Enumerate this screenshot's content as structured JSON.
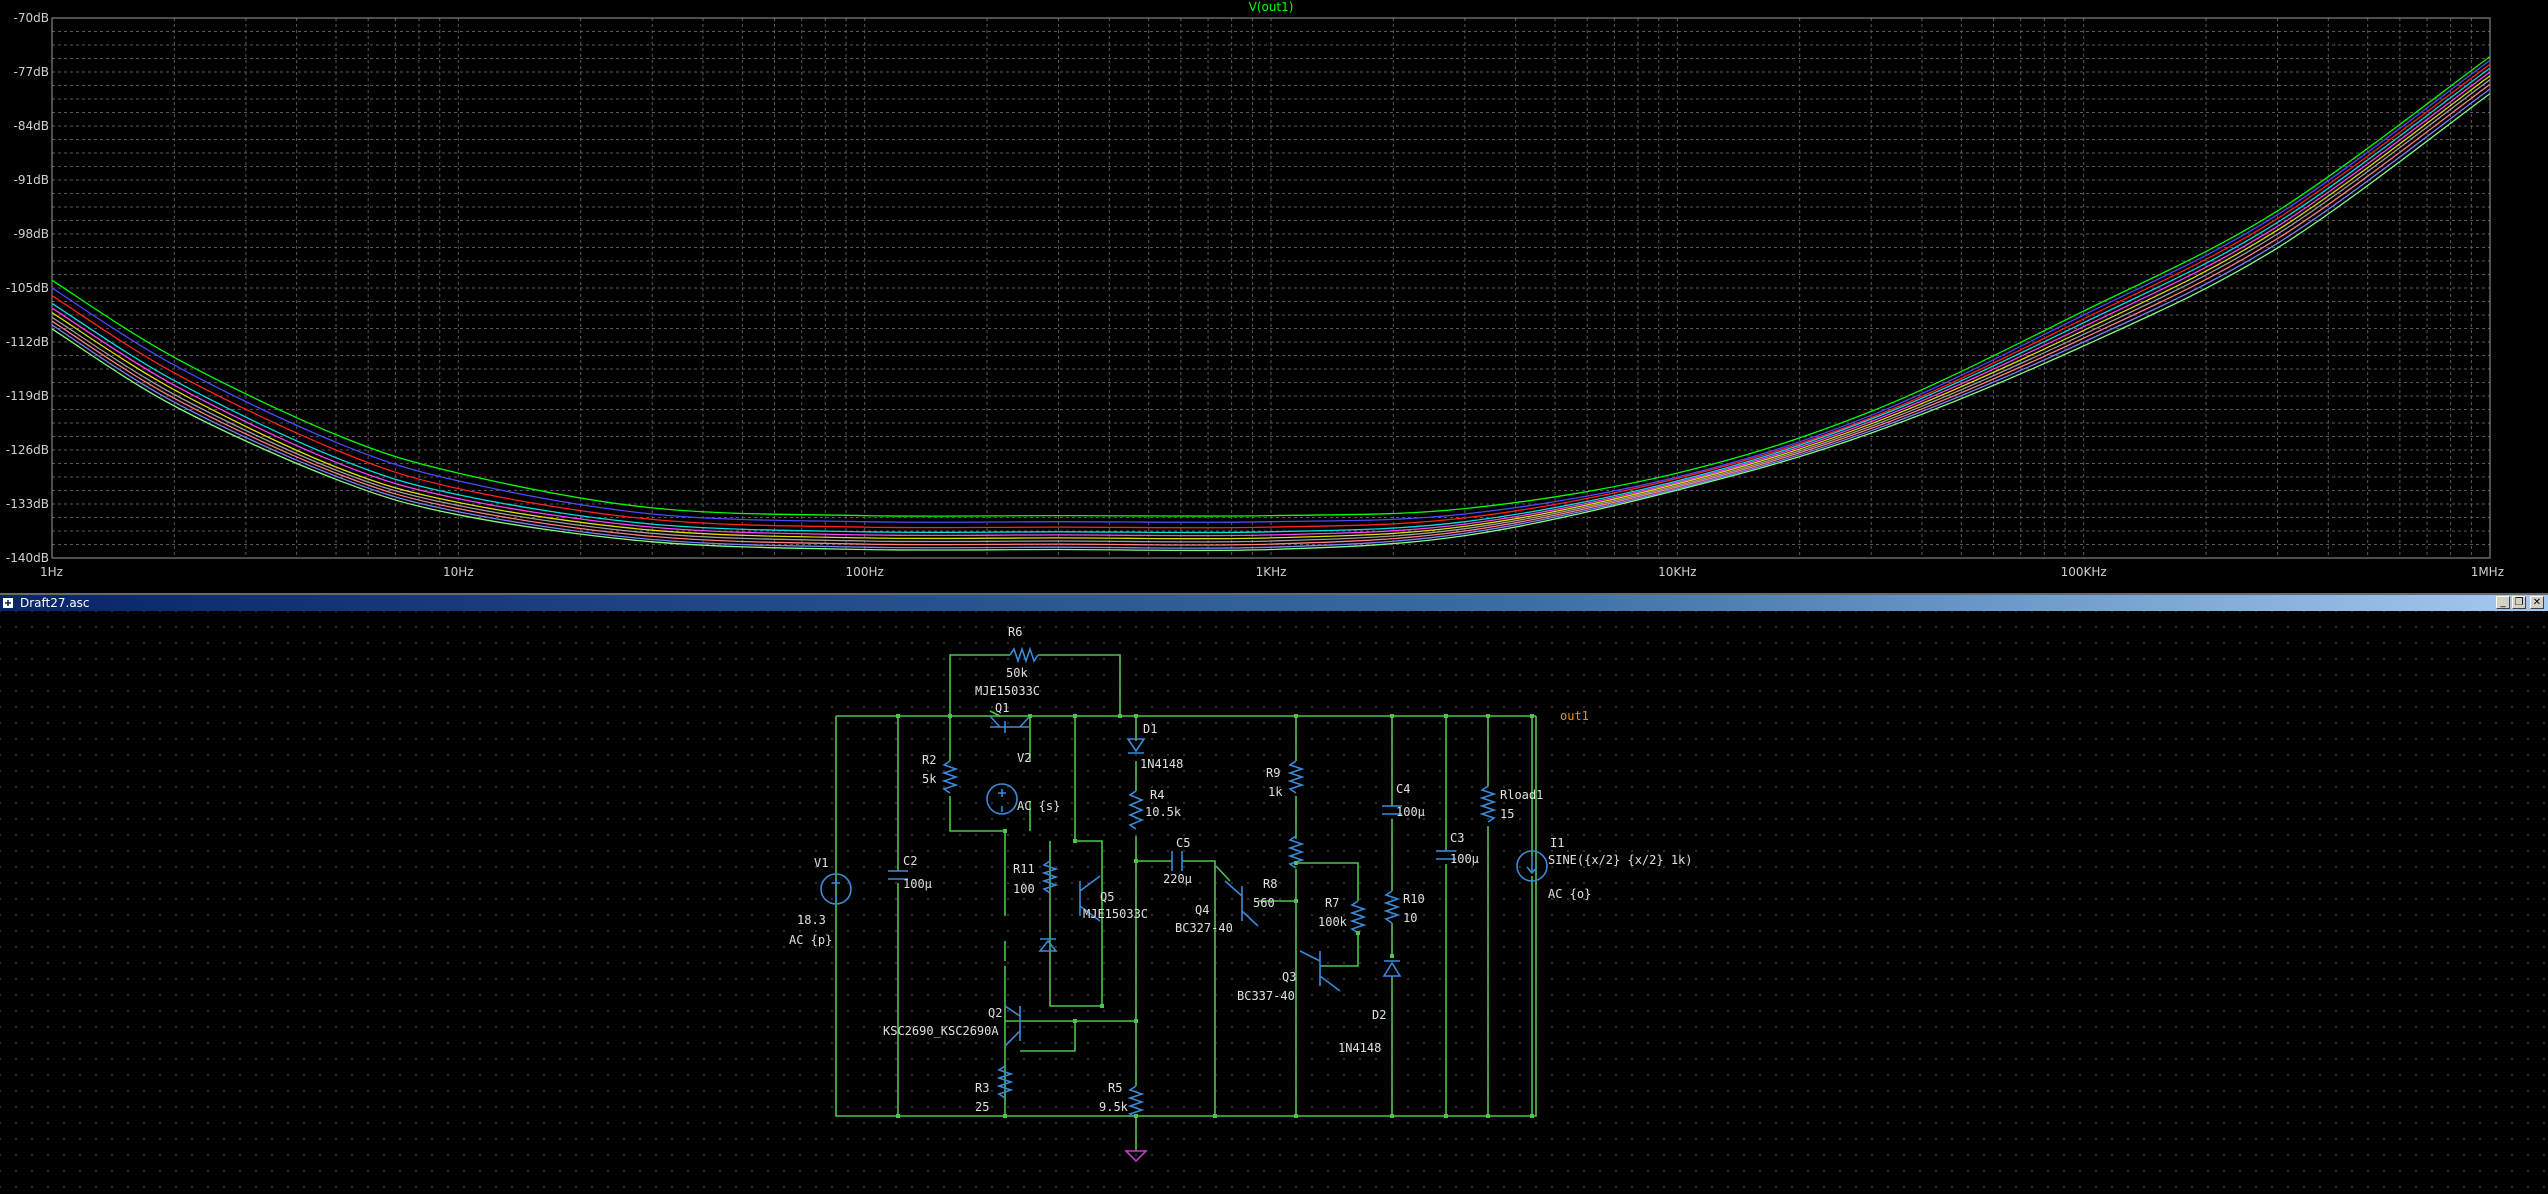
{
  "plot": {
    "trace_title": "V(out1)",
    "y_ticks": [
      "-70dB",
      "-77dB",
      "-84dB",
      "-91dB",
      "-98dB",
      "-105dB",
      "-112dB",
      "-119dB",
      "-126dB",
      "-133dB",
      "-140dB"
    ],
    "x_ticks": [
      "1Hz",
      "10Hz",
      "100Hz",
      "1KHz",
      "10KHz",
      "100KHz",
      "1MHz"
    ],
    "colors": {
      "title": "#00ff00",
      "grid": "#5a5a5a",
      "axis_text": "#d0d0d0"
    }
  },
  "chart_data": {
    "type": "line",
    "title": "V(out1)",
    "x_scale": "log",
    "xlim_hz": [
      1,
      1000000
    ],
    "ylim_db": [
      -140,
      -70
    ],
    "x_hz": [
      1,
      2,
      5,
      10,
      30,
      100,
      300,
      1000,
      3000,
      10000,
      30000,
      100000,
      300000,
      1000000
    ],
    "series": [
      {
        "color": "#00ff00",
        "values": [
          -104,
          -114,
          -124,
          -129,
          -133.5,
          -134.5,
          -134.5,
          -134.5,
          -133.6,
          -129,
          -121,
          -108,
          -95,
          -75
        ]
      },
      {
        "color": "#4a4aff",
        "values": [
          -105,
          -115,
          -125,
          -130,
          -134.3,
          -135.3,
          -135.3,
          -135.3,
          -134.3,
          -129.5,
          -121.5,
          -108.5,
          -95.5,
          -75.5
        ]
      },
      {
        "color": "#ff2020",
        "values": [
          -106,
          -116,
          -126,
          -131,
          -135,
          -136,
          -136,
          -136,
          -134.8,
          -129.7,
          -121.8,
          -109,
          -96,
          -76
        ]
      },
      {
        "color": "#00e0e0",
        "values": [
          -107,
          -117,
          -127,
          -131.8,
          -135.6,
          -136.6,
          -136.6,
          -136.6,
          -135.3,
          -130,
          -122,
          -109.5,
          -96.5,
          -76.5
        ]
      },
      {
        "color": "#ff40ff",
        "values": [
          -107.6,
          -117.6,
          -127.6,
          -132.3,
          -136,
          -137,
          -137,
          -137,
          -135.6,
          -130.2,
          -122.3,
          -110,
          -97,
          -77
        ]
      },
      {
        "color": "#e0e000",
        "values": [
          -108.2,
          -118.2,
          -128.2,
          -132.8,
          -136.4,
          -137.4,
          -137.4,
          -137.4,
          -135.9,
          -130.4,
          -122.6,
          -110.5,
          -97.5,
          -77.5
        ]
      },
      {
        "color": "#a0a0a0",
        "values": [
          -108.8,
          -118.8,
          -128.6,
          -133.2,
          -136.8,
          -137.8,
          -137.8,
          -137.8,
          -136.2,
          -130.6,
          -122.9,
          -111,
          -98,
          -78
        ]
      },
      {
        "color": "#ff8080",
        "values": [
          -109.3,
          -119.3,
          -129,
          -133.6,
          -137.2,
          -138.2,
          -138.2,
          -138.2,
          -136.5,
          -130.8,
          -123.2,
          -111.5,
          -98.6,
          -78.6
        ]
      },
      {
        "color": "#8080ff",
        "values": [
          -109.8,
          -119.8,
          -129.4,
          -134,
          -137.6,
          -138.6,
          -138.6,
          -138.6,
          -136.8,
          -131,
          -123.5,
          -112,
          -99.2,
          -79.2
        ]
      },
      {
        "color": "#80ff80",
        "values": [
          -110.3,
          -120.3,
          -129.8,
          -134.4,
          -137.9,
          -138.9,
          -138.9,
          -138.9,
          -137.1,
          -131.2,
          -123.8,
          -112.5,
          -99.8,
          -79.8
        ]
      }
    ]
  },
  "window": {
    "title": "Draft27.asc",
    "btn_min": "_",
    "btn_restore": "❐",
    "btn_close": "✕"
  },
  "schematic": {
    "colors": {
      "wire": "#4ec24e",
      "part": "#3a8ad8",
      "text": "#e0e0e0",
      "net_label": "#ff8c00",
      "ground": "#c040c0"
    },
    "labels": {
      "r6_name": "R6",
      "r6_val": "50k",
      "q1_model": "MJE15033C",
      "q1_name": "Q1",
      "d1_name": "D1",
      "d1_model": "1N4148",
      "net_out": "out1",
      "r2_name": "R2",
      "r2_val": "5k",
      "v2_name": "V2",
      "v2_ac": "AC {s}",
      "r4_name": "R4",
      "r4_val": "10.5k",
      "r9_name": "R9",
      "r9_val": "1k",
      "c4_name": "C4",
      "c4_val": "100µ",
      "rload_name": "Rload1",
      "rload_val": "15",
      "c5_name": "C5",
      "c5_val": "220µ",
      "c3_name": "C3",
      "c3_val": "100µ",
      "i1_name": "I1",
      "i1_val": "SINE({x/2} {x/2} 1k)",
      "i1_ac": "AC {o}",
      "v1_name": "V1",
      "v1_val": "18.3",
      "v1_ac": "AC {p}",
      "c2_name": "C2",
      "c2_val": "100µ",
      "r11_name": "R11",
      "r11_val": "100",
      "q5_name": "Q5",
      "q5_model": "MJE15033C",
      "r8_name": "R8",
      "r8_val": "560",
      "q4_name": "Q4",
      "q4_model": "BC327-40",
      "r7_name": "R7",
      "r7_val": "100k",
      "r10_name": "R10",
      "r10_val": "10",
      "q3_name": "Q3",
      "q3_model": "BC337-40",
      "d2_name": "D2",
      "d2_model": "1N4148",
      "q2_name": "Q2",
      "q2_model": "KSC2690_KSC2690A",
      "r3_name": "R3",
      "r3_val": "25",
      "r5_name": "R5",
      "r5_val": "9.5k"
    }
  }
}
